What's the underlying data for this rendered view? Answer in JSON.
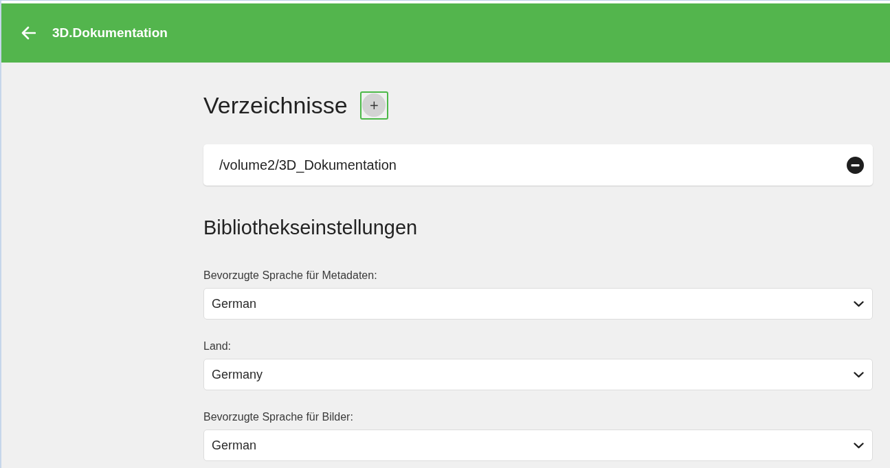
{
  "header": {
    "title": "3D.Dokumentation"
  },
  "directories": {
    "title": "Verzeichnisse",
    "add_button": {
      "label": "+",
      "focused": true
    },
    "items": [
      {
        "path": "/volume2/3D_Dokumentation"
      }
    ]
  },
  "library_settings": {
    "title": "Bibliothekseinstellungen",
    "fields": [
      {
        "label": "Bevorzugte Sprache für Metadaten:",
        "value": "German"
      },
      {
        "label": "Land:",
        "value": "Germany"
      },
      {
        "label": "Bevorzugte Sprache für Bilder:",
        "value": "German"
      }
    ]
  }
}
